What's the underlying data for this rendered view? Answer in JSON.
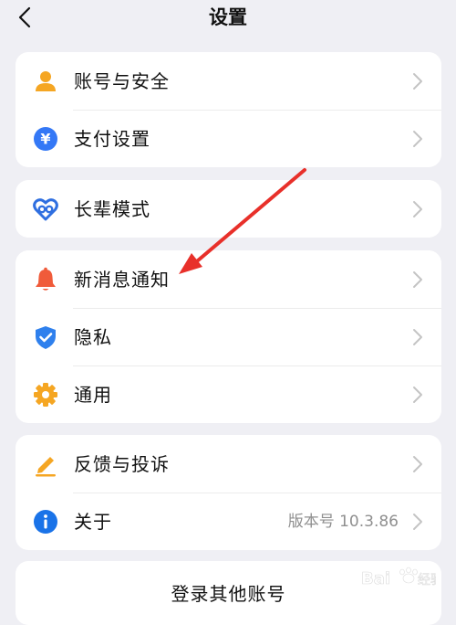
{
  "header": {
    "title": "设置"
  },
  "groups": [
    {
      "items": [
        {
          "label": "账号与安全",
          "icon": "user-icon",
          "color": "#f5a623"
        },
        {
          "label": "支付设置",
          "icon": "yuan-icon",
          "color": "#3478f6"
        }
      ]
    },
    {
      "items": [
        {
          "label": "长辈模式",
          "icon": "heart-icon",
          "color": "#2f6fe0"
        }
      ]
    },
    {
      "items": [
        {
          "label": "新消息通知",
          "icon": "bell-icon",
          "color": "#f05b3a"
        },
        {
          "label": "隐私",
          "icon": "shield-icon",
          "color": "#2f80ed"
        },
        {
          "label": "通用",
          "icon": "gear-icon",
          "color": "#f5a623"
        }
      ]
    },
    {
      "items": [
        {
          "label": "反馈与投诉",
          "icon": "edit-icon",
          "color": "#f5a623"
        },
        {
          "label": "关于",
          "icon": "info-icon",
          "color": "#1a73e8",
          "value": "版本号 10.3.86"
        }
      ]
    }
  ],
  "logout": {
    "label": "登录其他账号"
  },
  "annotation": {
    "arrow_color": "#e8302a"
  }
}
